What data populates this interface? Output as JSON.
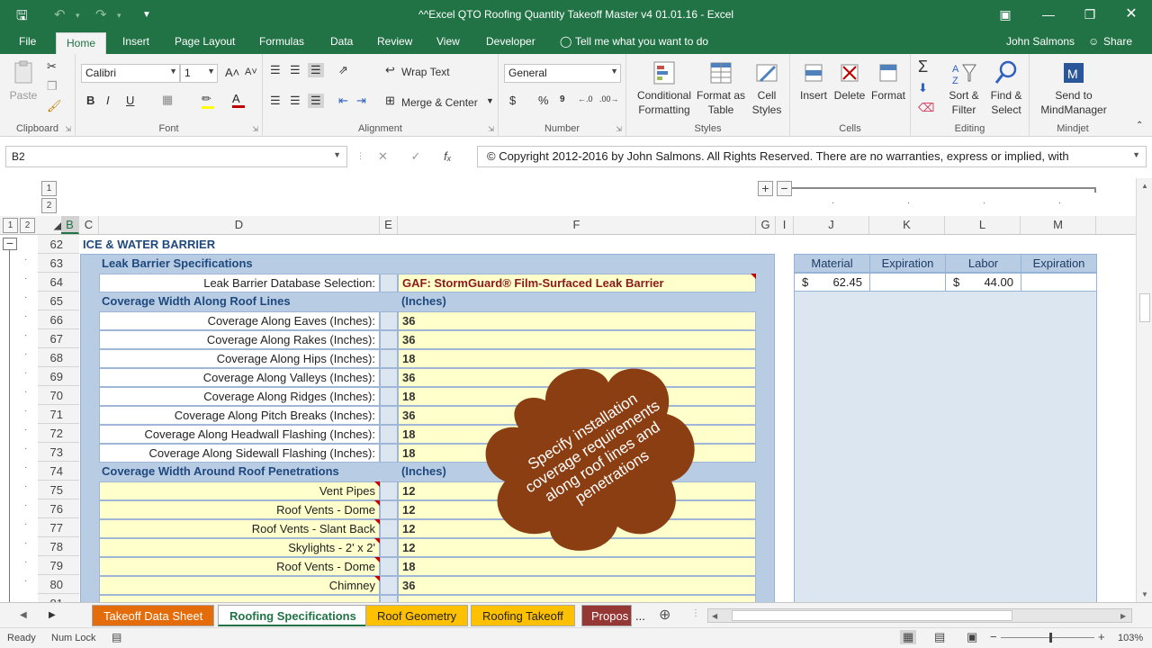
{
  "window": {
    "title": "^^Excel QTO Roofing Quantity Takeoff Master v4 01.01.16 - Excel"
  },
  "ribbon": {
    "tabs": [
      "File",
      "Home",
      "Insert",
      "Page Layout",
      "Formulas",
      "Data",
      "Review",
      "View",
      "Developer"
    ],
    "tell_me": "Tell me what you want to do",
    "user": "John Salmons",
    "share": "Share",
    "clipboard": {
      "paste": "Paste",
      "label": "Clipboard"
    },
    "font": {
      "name": "Calibri",
      "size": "1",
      "label": "Font"
    },
    "alignment": {
      "wrap": "Wrap Text",
      "merge": "Merge & Center",
      "label": "Alignment"
    },
    "number": {
      "format": "General",
      "label": "Number"
    },
    "styles": {
      "conditional": "Conditional",
      "formatting": "Formatting",
      "format_as": "Format as",
      "table": "Table",
      "cell": "Cell",
      "styles_word": "Styles",
      "label": "Styles"
    },
    "cells": {
      "insert": "Insert",
      "delete": "Delete",
      "format": "Format",
      "label": "Cells"
    },
    "editing": {
      "sort": "Sort &",
      "filter": "Filter",
      "find": "Find &",
      "select": "Select",
      "label": "Editing"
    },
    "mindjet": {
      "send": "Send to",
      "mm": "MindManager",
      "label": "Mindjet"
    }
  },
  "formula_bar": {
    "name_box": "B2",
    "formula": "© Copyright 2012-2016 by John Salmons. All Rights Reserved. There are no warranties, express or implied, with"
  },
  "outline_levels": [
    "1",
    "2"
  ],
  "columns": [
    "B",
    "C",
    "D",
    "E",
    "F",
    "G",
    "I",
    "J",
    "K",
    "L",
    "M"
  ],
  "rows": [
    "62",
    "63",
    "64",
    "65",
    "66",
    "67",
    "68",
    "69",
    "70",
    "71",
    "72",
    "73",
    "74",
    "75",
    "76",
    "77",
    "78",
    "79",
    "80",
    "81"
  ],
  "sheet": {
    "section_title": "ICE & WATER BARRIER",
    "spec_title": "Leak Barrier Specifications",
    "db_label": "Leak Barrier Database Selection:",
    "db_value": "GAF: StormGuard® Film-Surfaced Leak Barrier",
    "roof_lines_title": "Coverage Width Along Roof Lines",
    "roof_lines_unit": "(Inches)",
    "roof_lines": [
      {
        "label": "Coverage Along Eaves (Inches):",
        "value": "36"
      },
      {
        "label": "Coverage Along Rakes (Inches):",
        "value": "36"
      },
      {
        "label": "Coverage Along Hips (Inches):",
        "value": "18"
      },
      {
        "label": "Coverage Along Valleys (Inches):",
        "value": "36"
      },
      {
        "label": "Coverage Along Ridges (Inches):",
        "value": "18"
      },
      {
        "label": "Coverage Along Pitch Breaks (Inches):",
        "value": "36"
      },
      {
        "label": "Coverage Along Headwall Flashing (Inches):",
        "value": "18"
      },
      {
        "label": "Coverage Along Sidewall Flashing (Inches):",
        "value": "18"
      }
    ],
    "penetrations_title": "Coverage Width Around Roof Penetrations",
    "penetrations_unit": "(Inches)",
    "penetrations": [
      {
        "label": "Vent Pipes",
        "value": "12"
      },
      {
        "label": "Roof Vents - Dome",
        "value": "12"
      },
      {
        "label": "Roof Vents - Slant Back",
        "value": "12"
      },
      {
        "label": "Skylights - 2' x 2'",
        "value": "12"
      },
      {
        "label": "Roof Vents - Dome",
        "value": "18"
      },
      {
        "label": "Chimney",
        "value": "36"
      }
    ],
    "pricing": {
      "headers": [
        "Material",
        "Expiration",
        "Labor",
        "Expiration"
      ],
      "material_currency": "$",
      "material": "62.45",
      "labor_currency": "$",
      "labor": "44.00"
    },
    "callout": "Specify installation coverage requirements along roof lines and penetrations",
    "callout_color": "#8b3e12"
  },
  "sheet_tabs": [
    {
      "label": "Takeoff Data Sheet",
      "color": "#e46c0a"
    },
    {
      "label": "Roofing Specifications",
      "color": "#ffffff"
    },
    {
      "label": "Roof Geometry",
      "color": "#ffc000"
    },
    {
      "label": "Roofing Takeoff",
      "color": "#ffc000"
    },
    {
      "label": "Propos",
      "color": "#953735"
    }
  ],
  "sheet_more": "...",
  "status": {
    "ready": "Ready",
    "numlock": "Num Lock",
    "zoom": "103%"
  }
}
